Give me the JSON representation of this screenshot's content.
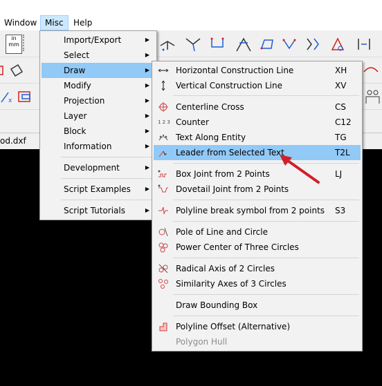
{
  "menubar": {
    "items": [
      {
        "label": "Window"
      },
      {
        "label": "Misc"
      },
      {
        "label": "Help"
      }
    ]
  },
  "toolbar_text": {
    "units_line1": "in",
    "units_line2": "mm"
  },
  "tab": {
    "filename": "od.dxf"
  },
  "misc_menu": {
    "items": [
      {
        "label": "Import/Export",
        "submenu": true
      },
      {
        "label": "Select",
        "submenu": true
      },
      {
        "label": "Draw",
        "submenu": true,
        "highlighted": true
      },
      {
        "label": "Modify",
        "submenu": true
      },
      {
        "label": "Projection",
        "submenu": true
      },
      {
        "label": "Layer",
        "submenu": true
      },
      {
        "label": "Block",
        "submenu": true
      },
      {
        "label": "Information",
        "submenu": true
      },
      {
        "label": "Development",
        "submenu": true
      },
      {
        "label": "Script Examples",
        "submenu": true
      },
      {
        "label": "Script Tutorials",
        "submenu": true
      }
    ]
  },
  "draw_menu": {
    "items": [
      {
        "label": "Horizontal Construction Line",
        "shortcut": "XH",
        "icon": "horizontal-line-icon"
      },
      {
        "label": "Vertical Construction Line",
        "shortcut": "XV",
        "icon": "vertical-line-icon"
      },
      {
        "label": "Centerline Cross",
        "shortcut": "CS",
        "icon": "centerline-cross-icon"
      },
      {
        "label": "Counter",
        "shortcut": "C12",
        "icon": "counter-icon",
        "icon_text": "1 2 3"
      },
      {
        "label": "Text Along Entity",
        "shortcut": "TG",
        "icon": "text-along-entity-icon"
      },
      {
        "label": "Leader from Selected Text",
        "shortcut": "T2L",
        "icon": "leader-icon",
        "highlighted": true
      },
      {
        "label": "Box Joint from 2 Points",
        "shortcut": "LJ",
        "icon": "box-joint-icon"
      },
      {
        "label": "Dovetail Joint from 2 Points",
        "shortcut": "",
        "icon": "dovetail-joint-icon"
      },
      {
        "label": "Polyline break symbol from 2 points",
        "shortcut": "S3",
        "icon": "polyline-break-icon"
      },
      {
        "label": "Pole of Line and Circle",
        "shortcut": "",
        "icon": "pole-icon"
      },
      {
        "label": "Power Center of Three Circles",
        "shortcut": "",
        "icon": "power-center-icon"
      },
      {
        "label": "Radical Axis of 2 Circles",
        "shortcut": "",
        "icon": "radical-axis-icon"
      },
      {
        "label": "Similarity Axes of 3 Circles",
        "shortcut": "",
        "icon": "similarity-axes-icon"
      },
      {
        "label": "Draw Bounding Box",
        "shortcut": "",
        "icon": ""
      },
      {
        "label": "Polyline Offset (Alternative)",
        "shortcut": "",
        "icon": "polyline-offset-icon"
      },
      {
        "label": "Polygon Hull",
        "shortcut": "",
        "icon": "",
        "disabled": true
      }
    ]
  },
  "annotation": {
    "arrow_color": "#d0202a"
  }
}
